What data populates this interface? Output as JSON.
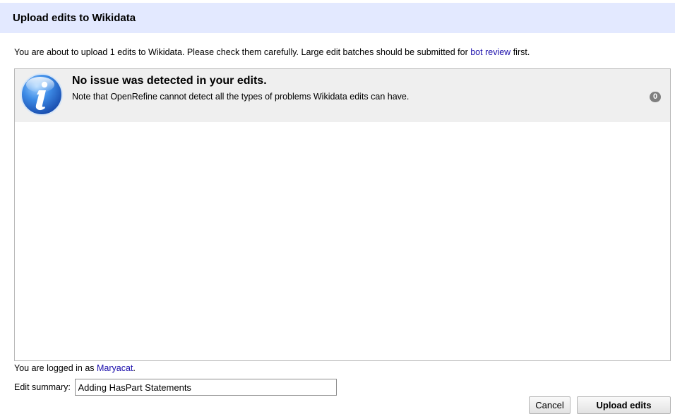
{
  "dialog": {
    "title": "Upload edits to Wikidata",
    "intro_before": "You are about to upload 1 edits to Wikidata. Please check them carefully. Large edit batches should be submitted for ",
    "intro_link": "bot review",
    "intro_after": " first."
  },
  "issues": {
    "icon": "info-icon",
    "title": "No issue was detected in your edits.",
    "note": "Note that OpenRefine cannot detect all the types of problems Wikidata edits can have.",
    "count": "0"
  },
  "login": {
    "prefix": "You are logged in as ",
    "username": "Maryacat",
    "suffix": "."
  },
  "summary": {
    "label": "Edit summary:",
    "value": "Adding HasPart Statements"
  },
  "buttons": {
    "cancel": "Cancel",
    "upload": "Upload edits"
  },
  "colors": {
    "header_bg": "#e3e9ff",
    "link": "#1a0dab",
    "issue_row_bg": "#efefef",
    "badge_bg": "#7f7f7f"
  }
}
